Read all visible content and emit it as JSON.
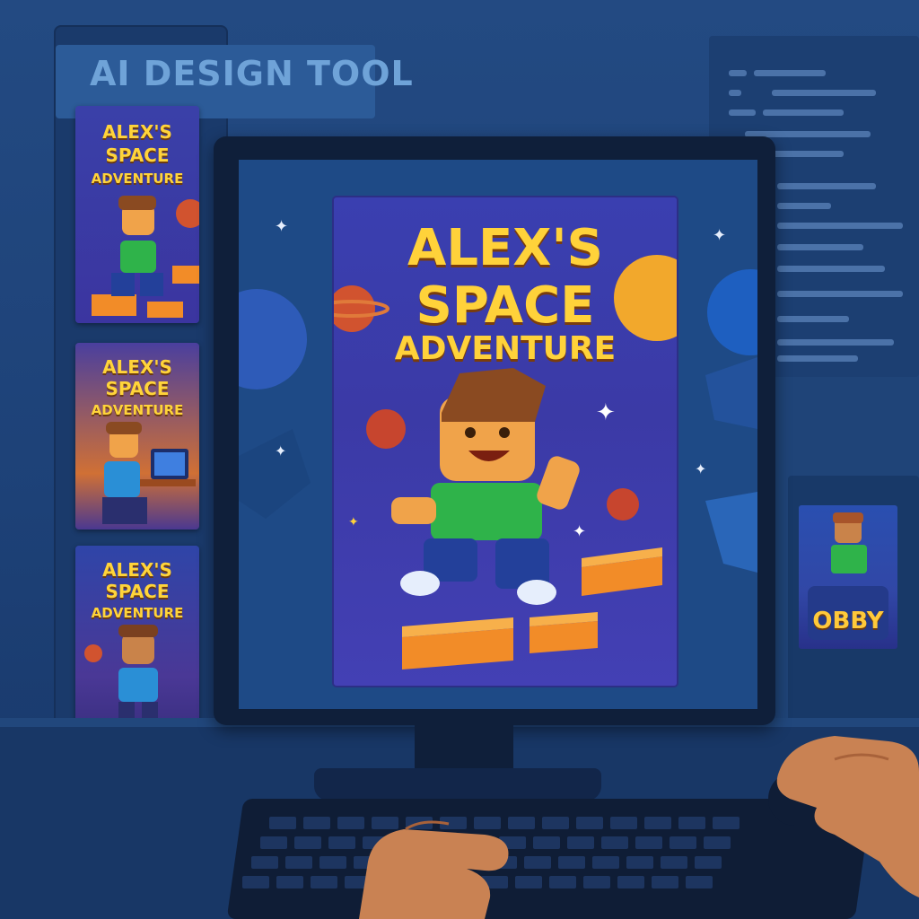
{
  "app": {
    "title": "AI DESIGN TOOL"
  },
  "main_poster": {
    "title_line1": "ALEX'S",
    "title_line2": "SPACE",
    "title_line3": "ADVENTURE"
  },
  "thumbnails": [
    {
      "line1": "ALEX'S",
      "line2": "SPACE",
      "line3": "ADVENTURE"
    },
    {
      "line1": "ALEX'S",
      "line2": "SPACE",
      "line3": "ADVENTURE"
    },
    {
      "line1": "ALEX'S",
      "line2": "SPACE",
      "line3": "ADVENTURE"
    }
  ],
  "side_card": {
    "label": "OBBY"
  },
  "colors": {
    "title_yellow": "#ffd23a",
    "background_blue": "#1c3f73",
    "poster_purple": "#3b3aa6",
    "brick_orange": "#f28c28",
    "shirt_green": "#2fb34a"
  },
  "icons": [
    "star-icon",
    "planet-icon",
    "character-figure",
    "hand-icon"
  ]
}
